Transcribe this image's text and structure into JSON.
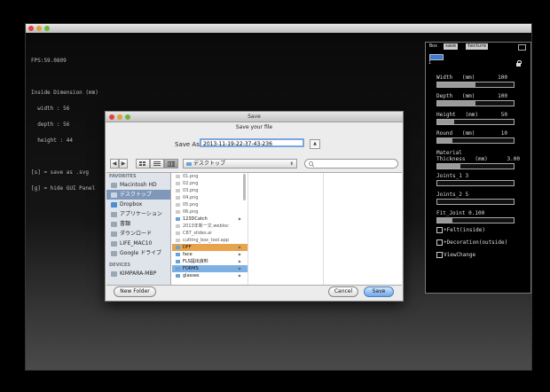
{
  "hud": {
    "fps": "FPS:59.0809",
    "title": "Inside Dimension (mm)",
    "width": "  width : 56",
    "depth": "  depth : 56",
    "height": "  height : 44",
    "save_hint": "[s] = save as .svg",
    "gui_hint": "[g] = hide GUI Panel"
  },
  "panel": {
    "tabs": [
      "Box",
      "save",
      "texture"
    ],
    "number": "1",
    "params": [
      {
        "label": "Width   (mm)",
        "value": "100",
        "fill": 0.5
      },
      {
        "label": "Depth   (mm)",
        "value": "100",
        "fill": 0.5
      },
      {
        "label": "Height   (mm)",
        "value": "50",
        "fill": 0.22
      },
      {
        "label": "Round   (mm)",
        "value": "10",
        "fill": 0.2
      },
      {
        "label": "Joints_1 3",
        "value": "",
        "fill": 0.0
      },
      {
        "label": "Joints_2 5",
        "value": "",
        "fill": 0.0
      },
      {
        "label": "Fit_Joint 0.100",
        "value": "",
        "fill": 0.2
      }
    ],
    "material_label_1": "Material",
    "material_label_2": "Thickness   (mm)",
    "material_value": "3.00",
    "material_fill": 0.3,
    "checks": [
      "+Felt(inside)",
      "+Decoration(outside)",
      "ViewChange"
    ]
  },
  "dialog": {
    "title": "Save",
    "subtitle": "Save your file",
    "save_as_label": "Save As:",
    "filename": "2013-11-19-22-37-43-236",
    "expand_icon": "▲",
    "back": "◀",
    "forward": "▶",
    "view_icon": "icon-view",
    "view_list": "list-view",
    "view_column": "column-view",
    "location": "デスクトップ",
    "search_placeholder": "",
    "favorites_header": "FAVORITES",
    "devices_header": "DEVICES",
    "favorites": [
      "Macintosh HD",
      "デスクトップ",
      "Dropbox",
      "アプリケーション",
      "書類",
      "ダウンロード",
      "LIFE_MAC10",
      "Google ドライブ"
    ],
    "devices": [
      "KIMPARA-MBP"
    ],
    "files": [
      {
        "name": "01.png",
        "dir": false
      },
      {
        "name": "02.png",
        "dir": false
      },
      {
        "name": "03.png",
        "dir": false
      },
      {
        "name": "04.png",
        "dir": false
      },
      {
        "name": "05.png",
        "dir": false
      },
      {
        "name": "06.png",
        "dir": false
      },
      {
        "name": "123DCatch",
        "dir": true
      },
      {
        "name": "2013年新一文.webloc",
        "dir": false
      },
      {
        "name": "C87_slides.ai",
        "dir": false
      },
      {
        "name": "cutting_box_tool.app",
        "dir": false
      },
      {
        "name": "DFF",
        "dir": true
      },
      {
        "name": "face",
        "dir": true
      },
      {
        "name": "FLS提出資料",
        "dir": true
      },
      {
        "name": "FORMS",
        "dir": true
      },
      {
        "name": "glasses",
        "dir": true
      }
    ],
    "new_folder": "New Folder",
    "cancel": "Cancel",
    "save": "Save"
  }
}
